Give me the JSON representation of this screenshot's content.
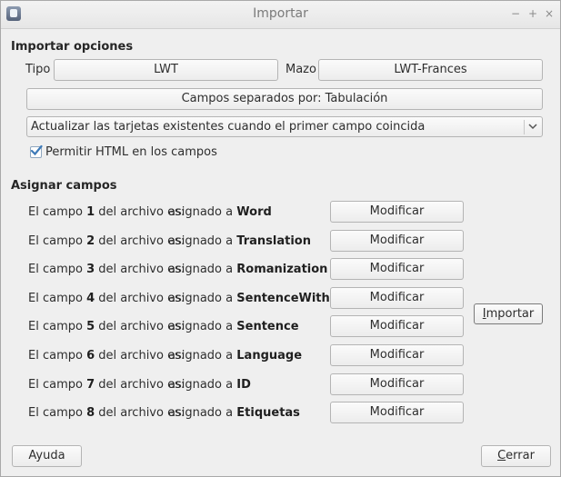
{
  "window": {
    "title": "Importar",
    "controls": [
      "−",
      "+",
      "×"
    ]
  },
  "import_options": {
    "heading": "Importar opciones",
    "type_label": "Tipo",
    "type_value": "LWT",
    "deck_label": "Mazo",
    "deck_value": "LWT-Frances",
    "separator_button": "Campos separados por: Tabulación",
    "update_mode": "Actualizar las tarjetas existentes cuando el primer campo coincida",
    "allow_html_label": "Permitir HTML en los campos",
    "allow_html_checked": true
  },
  "assign_fields": {
    "heading": "Asignar campos",
    "row_prefix": "El campo",
    "row_middle": "del archivo es:",
    "assigned_prefix": "asignado a",
    "modify_label": "Modificar",
    "rows": [
      {
        "num": "1",
        "target": "Word"
      },
      {
        "num": "2",
        "target": "Translation"
      },
      {
        "num": "3",
        "target": "Romanization"
      },
      {
        "num": "4",
        "target": "SentenceWithGap"
      },
      {
        "num": "5",
        "target": "Sentence"
      },
      {
        "num": "6",
        "target": "Language"
      },
      {
        "num": "7",
        "target": "ID"
      },
      {
        "num": "8",
        "target": "Etiquetas"
      }
    ]
  },
  "buttons": {
    "import_mnemonic": "I",
    "import_rest": "mportar",
    "help": "Ayuda",
    "close_mnemonic": "C",
    "close_rest": "errar"
  },
  "icons": {
    "app": "app-icon",
    "dropdown": "chevron-down-icon",
    "checkbox": "checkmark-icon"
  },
  "colors": {
    "check": "#3d7ab8"
  }
}
